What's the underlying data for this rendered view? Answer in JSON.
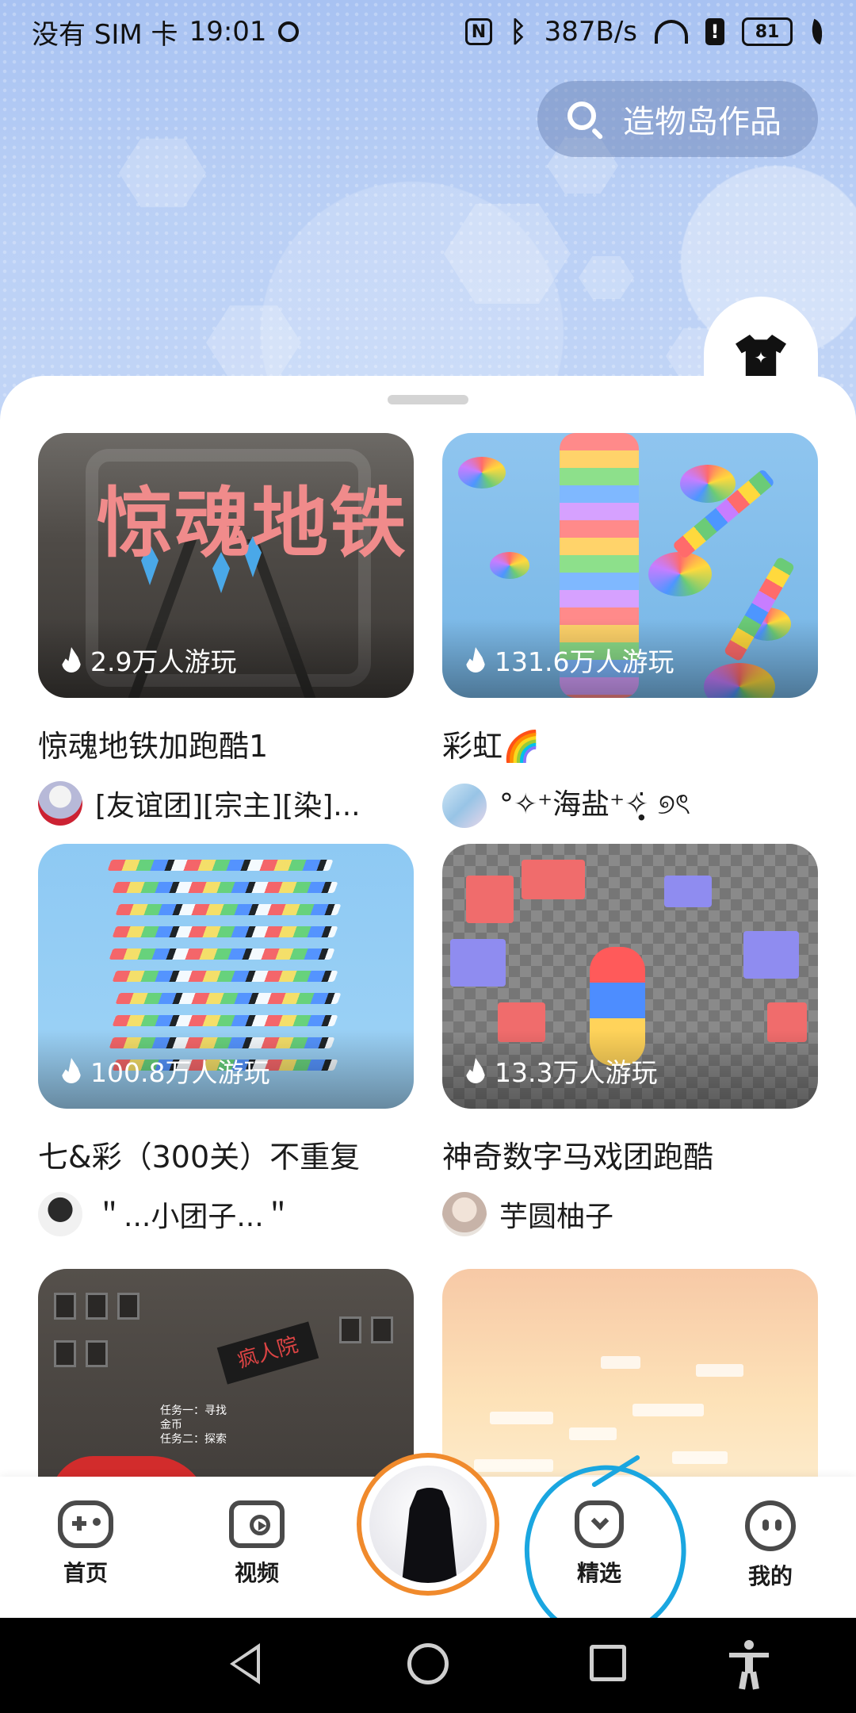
{
  "status_bar": {
    "carrier": "没有 SIM 卡",
    "time": "19:01",
    "network_speed": "387B/s",
    "battery": "81",
    "icons": [
      "hotspot-icon",
      "nfc-icon",
      "bluetooth-icon",
      "wifi-icon",
      "alert-icon",
      "battery-icon",
      "eco-leaf-icon"
    ]
  },
  "header": {
    "search_label": "造物岛作品"
  },
  "feed": {
    "items": [
      {
        "title": "惊魂地铁加跑酷1",
        "plays": "2.9万人游玩",
        "author": "[友谊团][宗主][染]...",
        "thumb_text": "惊魂地铁"
      },
      {
        "title": "彩虹🌈",
        "plays": "131.6万人游玩",
        "author": "°✧⁺海盐⁺✧̣̥̇ ୭ৎ"
      },
      {
        "title": "七&彩（300关）不重复",
        "plays": "100.8万人游玩",
        "author": "＂...小团子...＂"
      },
      {
        "title": "神奇数字马戏团跑酷",
        "plays": "13.3万人游玩",
        "author": "芋圆柚子"
      },
      {
        "title": "",
        "plays": "",
        "author": "",
        "thumb_sign": "疯人院",
        "thumb_text": "任务一：寻找\n金币\n任务二：探索"
      },
      {
        "title": "",
        "plays": "",
        "author": ""
      }
    ]
  },
  "bottom_nav": {
    "items": [
      {
        "label": "首页",
        "icon": "gamepad-icon"
      },
      {
        "label": "视频",
        "icon": "video-icon"
      },
      {
        "label": "",
        "icon": "avatar-character"
      },
      {
        "label": "精选",
        "icon": "featured-icon"
      },
      {
        "label": "我的",
        "icon": "face-icon"
      }
    ]
  },
  "colors": {
    "avatar_ring": "#f08a2c",
    "annotation": "#1aa6e0",
    "header_bg": "#b9cff5"
  }
}
